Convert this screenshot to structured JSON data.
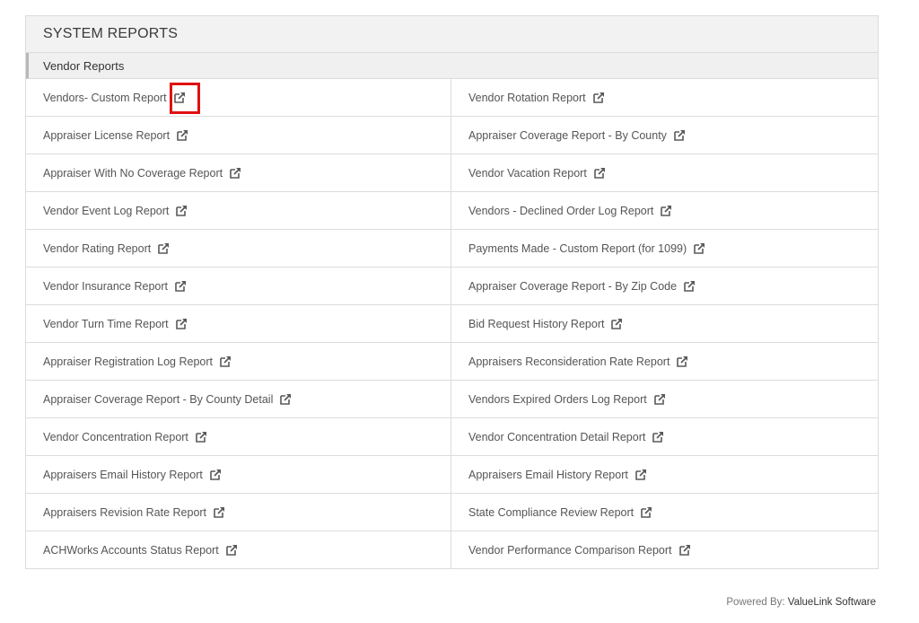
{
  "panel": {
    "title": "SYSTEM REPORTS",
    "section": "Vendor Reports"
  },
  "rows": [
    [
      "Vendors- Custom Report",
      "Vendor Rotation Report"
    ],
    [
      "Appraiser License Report",
      "Appraiser Coverage Report - By County"
    ],
    [
      "Appraiser With No Coverage Report",
      "Vendor Vacation Report"
    ],
    [
      "Vendor Event Log Report",
      "Vendors - Declined Order Log Report"
    ],
    [
      "Vendor Rating Report",
      "Payments Made - Custom Report (for 1099)"
    ],
    [
      "Vendor Insurance Report",
      "Appraiser Coverage Report - By Zip Code"
    ],
    [
      "Vendor Turn Time Report",
      "Bid Request History Report"
    ],
    [
      "Appraiser Registration Log Report",
      "Appraisers Reconsideration Rate Report"
    ],
    [
      "Appraiser Coverage Report - By County Detail",
      "Vendors Expired Orders Log Report"
    ],
    [
      "Vendor Concentration Report",
      "Vendor Concentration Detail Report"
    ],
    [
      "Appraisers Email History Report",
      "Appraisers Email History Report"
    ],
    [
      "Appraisers Revision Rate Report",
      "State Compliance Review Report"
    ],
    [
      "ACHWorks Accounts Status Report",
      "Vendor Performance Comparison Report"
    ]
  ],
  "icons": {
    "link": "external-link-icon"
  },
  "colors": {
    "highlight": "#e01010",
    "icon": "#5a5a5a"
  },
  "footer": {
    "prefix": "Powered By:",
    "brand": "ValueLink Software"
  }
}
